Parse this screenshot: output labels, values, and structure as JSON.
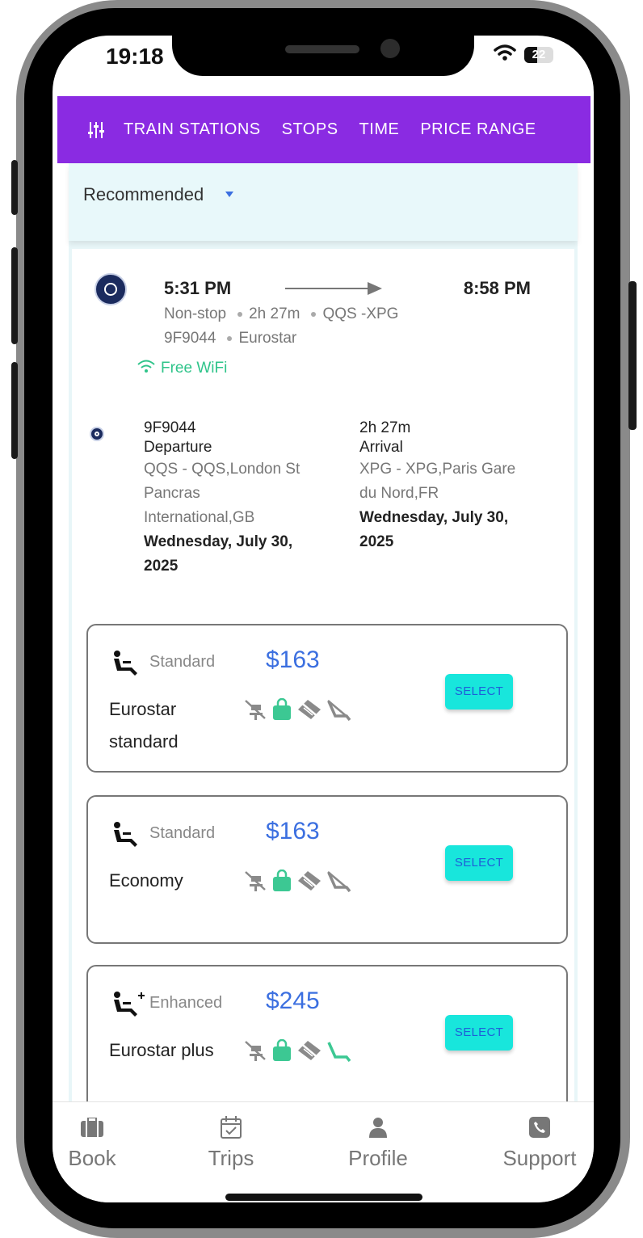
{
  "status_bar": {
    "time": "19:18",
    "battery": "22"
  },
  "filters": {
    "items": [
      "TRAIN STATIONS",
      "STOPS",
      "TIME",
      "PRICE RANGE"
    ]
  },
  "sort": {
    "label": "Recommended"
  },
  "trip": {
    "depart_time": "5:31 PM",
    "arrive_time": "8:58 PM",
    "stops": "Non-stop",
    "duration": "2h 27m",
    "route": "QQS -XPG",
    "train_number": "9F9044",
    "operator": "Eurostar",
    "amenity": "Free WiFi"
  },
  "segment": {
    "train_number": "9F9044",
    "duration": "2h 27m",
    "departure_label": "Departure",
    "departure_station": "QQS - QQS,London St Pancras International,GB",
    "departure_date": "Wednesday, July 30, 2025",
    "arrival_label": "Arrival",
    "arrival_station": "XPG - XPG,Paris Gare du Nord,FR",
    "arrival_date": "Wednesday, July 30, 2025"
  },
  "fares": [
    {
      "class": "Standard",
      "price": "$163",
      "name": "Eurostar standard",
      "select": "SELECT"
    },
    {
      "class": "Standard",
      "price": "$163",
      "name": "Economy",
      "select": "SELECT"
    },
    {
      "class": "Enhanced",
      "price": "$245",
      "name": "Eurostar plus",
      "select": "SELECT"
    }
  ],
  "tabs": [
    {
      "label": "Book",
      "icon": "briefcase-icon"
    },
    {
      "label": "Trips",
      "icon": "calendar-check-icon"
    },
    {
      "label": "Profile",
      "icon": "person-icon"
    },
    {
      "label": "Support",
      "icon": "phone-icon"
    }
  ],
  "colors": {
    "filter_bar": "#8a2be2",
    "price": "#3b6fe0",
    "select_button": "#18e6dc",
    "wifi": "#2fc48a",
    "amenity_active": "#3cc893",
    "amenity_inactive": "#8a8a8a"
  }
}
